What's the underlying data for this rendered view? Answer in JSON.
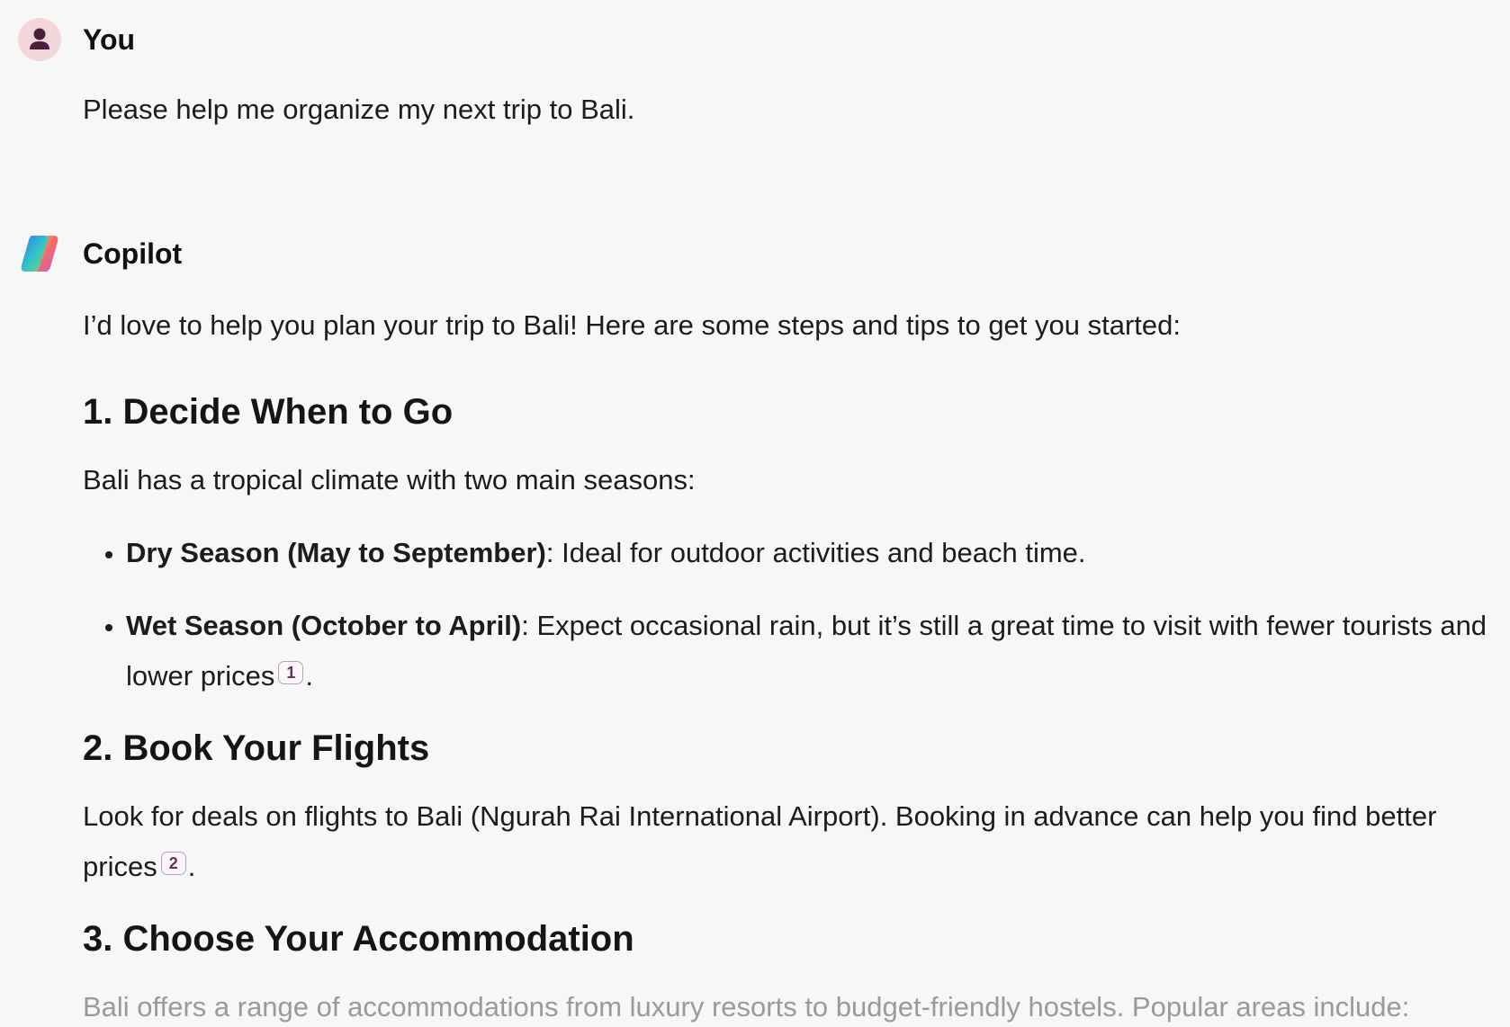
{
  "user_message": {
    "author": "You",
    "text": "Please help me organize my next trip to Bali."
  },
  "assistant_message": {
    "author": "Copilot",
    "intro": "I’d love to help you plan your trip to Bali! Here are some steps and tips to get you started:",
    "section1": {
      "heading": "1. Decide When to Go",
      "text": "Bali has a tropical climate with two main seasons:",
      "bullets": [
        {
          "bold": "Dry Season (May to September)",
          "text": ": Ideal for outdoor activities and beach time."
        },
        {
          "bold": "Wet Season (October to April)",
          "text": ": Expect occasional rain, but it’s still a great time to visit with fewer tourists and lower prices",
          "citation": "1",
          "end": "."
        }
      ]
    },
    "section2": {
      "heading": "2. Book Your Flights",
      "text": "Look for deals on flights to Bali (Ngurah Rai International Airport). Booking in advance can help you find better prices",
      "citation": "2",
      "end": "."
    },
    "section3": {
      "heading": "3. Choose Your Accommodation",
      "text": "Bali offers a range of accommodations from luxury resorts to budget-friendly hostels. Popular areas include:"
    }
  },
  "colors": {
    "background": "#f7f7f7",
    "avatar_bg": "#f2d6d9",
    "avatar_icon": "#4a1f3d",
    "citation": "#6b2f5d"
  },
  "icons": {
    "user_avatar": "person-icon",
    "assistant_avatar": "copilot-logo-icon"
  }
}
